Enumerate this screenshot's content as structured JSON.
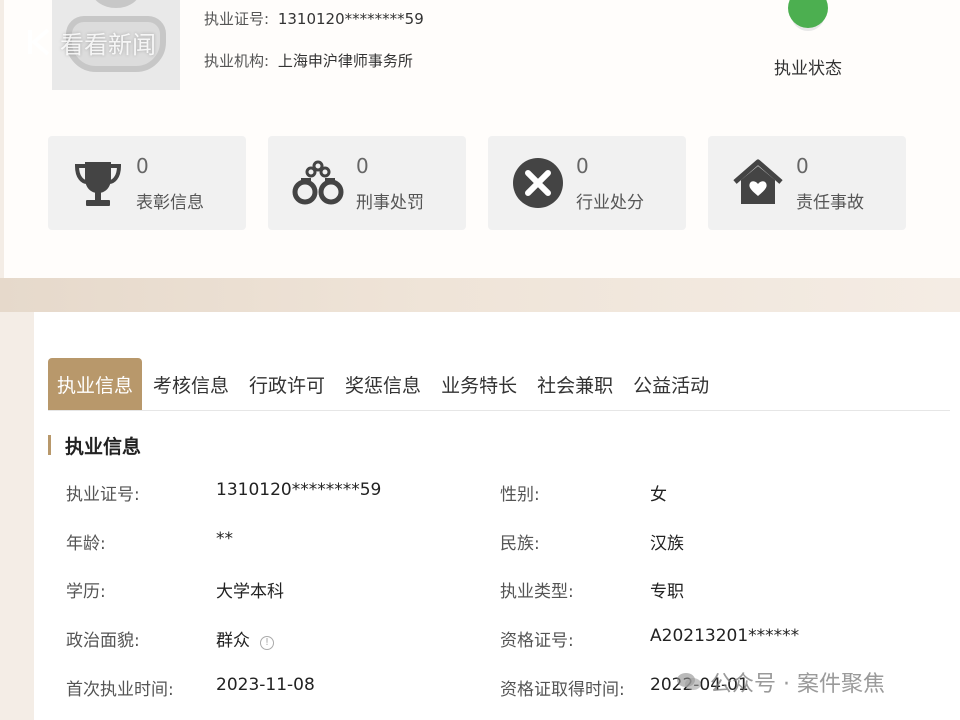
{
  "profile": {
    "license_label": "执业证号:",
    "license_value": "1310120********59",
    "org_label": "执业机构:",
    "org_value": "上海申沪律师事务所",
    "status_label": "执业状态",
    "status_color": "#4caf50"
  },
  "watermark_top": "看看新闻",
  "stats": [
    {
      "count": "0",
      "label": "表彰信息",
      "icon": "trophy-icon"
    },
    {
      "count": "0",
      "label": "刑事处罚",
      "icon": "handcuffs-icon"
    },
    {
      "count": "0",
      "label": "行业处分",
      "icon": "close-circle-icon"
    },
    {
      "count": "0",
      "label": "责任事故",
      "icon": "house-heart-icon"
    }
  ],
  "tabs": [
    "执业信息",
    "考核信息",
    "行政许可",
    "奖惩信息",
    "业务特长",
    "社会兼职",
    "公益活动"
  ],
  "active_tab": "执业信息",
  "section_title": "执业信息",
  "details": {
    "left": [
      {
        "label": "执业证号:",
        "value": "1310120********59"
      },
      {
        "label": "年龄:",
        "value": "**"
      },
      {
        "label": "学历:",
        "value": "大学本科"
      },
      {
        "label": "政治面貌:",
        "value": "群众"
      },
      {
        "label": "首次执业时间:",
        "value": "2023-11-08"
      }
    ],
    "right": [
      {
        "label": "性别:",
        "value": "女"
      },
      {
        "label": "民族:",
        "value": "汉族"
      },
      {
        "label": "执业类型:",
        "value": "专职"
      },
      {
        "label": "资格证号:",
        "value": "A20213201******"
      },
      {
        "label": "资格证取得时间:",
        "value": "2022-04-01"
      }
    ]
  },
  "watermark_bottom": "公众号 · 案件聚焦",
  "colors": {
    "accent": "#b8986b",
    "icon": "#444444"
  }
}
